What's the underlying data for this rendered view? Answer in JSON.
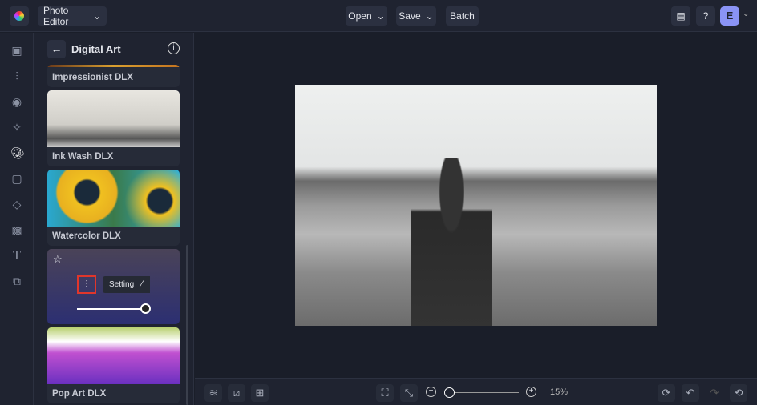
{
  "header": {
    "app_menu": "Photo Editor",
    "open": "Open",
    "save": "Save",
    "batch": "Batch",
    "avatar_initial": "E"
  },
  "panel": {
    "title": "Digital Art",
    "items": [
      {
        "label": "Impressionist DLX"
      },
      {
        "label": "Ink Wash DLX"
      },
      {
        "label": "Watercolor DLX"
      },
      {
        "label": "Pop Art DLX"
      }
    ],
    "tooltip": "Settings",
    "intensity": 1.0
  },
  "bottom": {
    "zoom": "15%",
    "zoom_fraction": 0.0
  },
  "colors": {
    "accent": "#8a93f5",
    "highlight": "#e0362b"
  }
}
